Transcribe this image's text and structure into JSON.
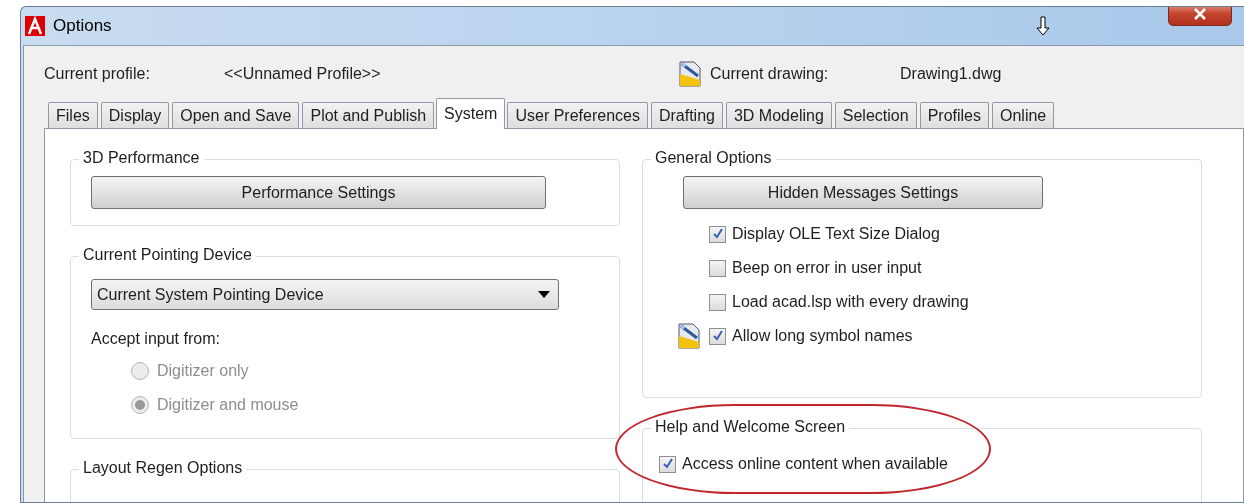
{
  "window": {
    "title": "Options"
  },
  "profile": {
    "label": "Current profile:",
    "value": "<<Unnamed Profile>>"
  },
  "drawing": {
    "label": "Current drawing:",
    "value": "Drawing1.dwg"
  },
  "tabs": [
    {
      "label": "Files",
      "selected": false
    },
    {
      "label": "Display",
      "selected": false
    },
    {
      "label": "Open and Save",
      "selected": false
    },
    {
      "label": "Plot and Publish",
      "selected": false
    },
    {
      "label": "System",
      "selected": true
    },
    {
      "label": "User Preferences",
      "selected": false
    },
    {
      "label": "Drafting",
      "selected": false
    },
    {
      "label": "3D Modeling",
      "selected": false
    },
    {
      "label": "Selection",
      "selected": false
    },
    {
      "label": "Profiles",
      "selected": false
    },
    {
      "label": "Online",
      "selected": false
    }
  ],
  "performance": {
    "title": "3D Performance",
    "button": "Performance Settings"
  },
  "pointing_device": {
    "title": "Current Pointing Device",
    "dropdown": "Current System Pointing Device",
    "accept_label": "Accept input from:",
    "radios": [
      {
        "label": "Digitizer only",
        "selected": false,
        "disabled": true
      },
      {
        "label": "Digitizer and mouse",
        "selected": true,
        "disabled": true
      }
    ]
  },
  "layout_regen": {
    "title": "Layout Regen Options"
  },
  "general_options": {
    "title": "General Options",
    "button": "Hidden Messages Settings",
    "checkboxes": [
      {
        "label": "Display OLE Text Size Dialog",
        "checked": true,
        "saved_in_drawing": false
      },
      {
        "label": "Beep on error in user input",
        "checked": false,
        "saved_in_drawing": false
      },
      {
        "label": "Load acad.lsp with every drawing",
        "checked": false,
        "saved_in_drawing": false
      },
      {
        "label": "Allow long symbol names",
        "checked": true,
        "saved_in_drawing": true
      }
    ]
  },
  "help_welcome": {
    "title": "Help and Welcome Screen",
    "checkboxes": [
      {
        "label": "Access online content when available",
        "checked": true,
        "saved_in_drawing": false
      }
    ]
  }
}
